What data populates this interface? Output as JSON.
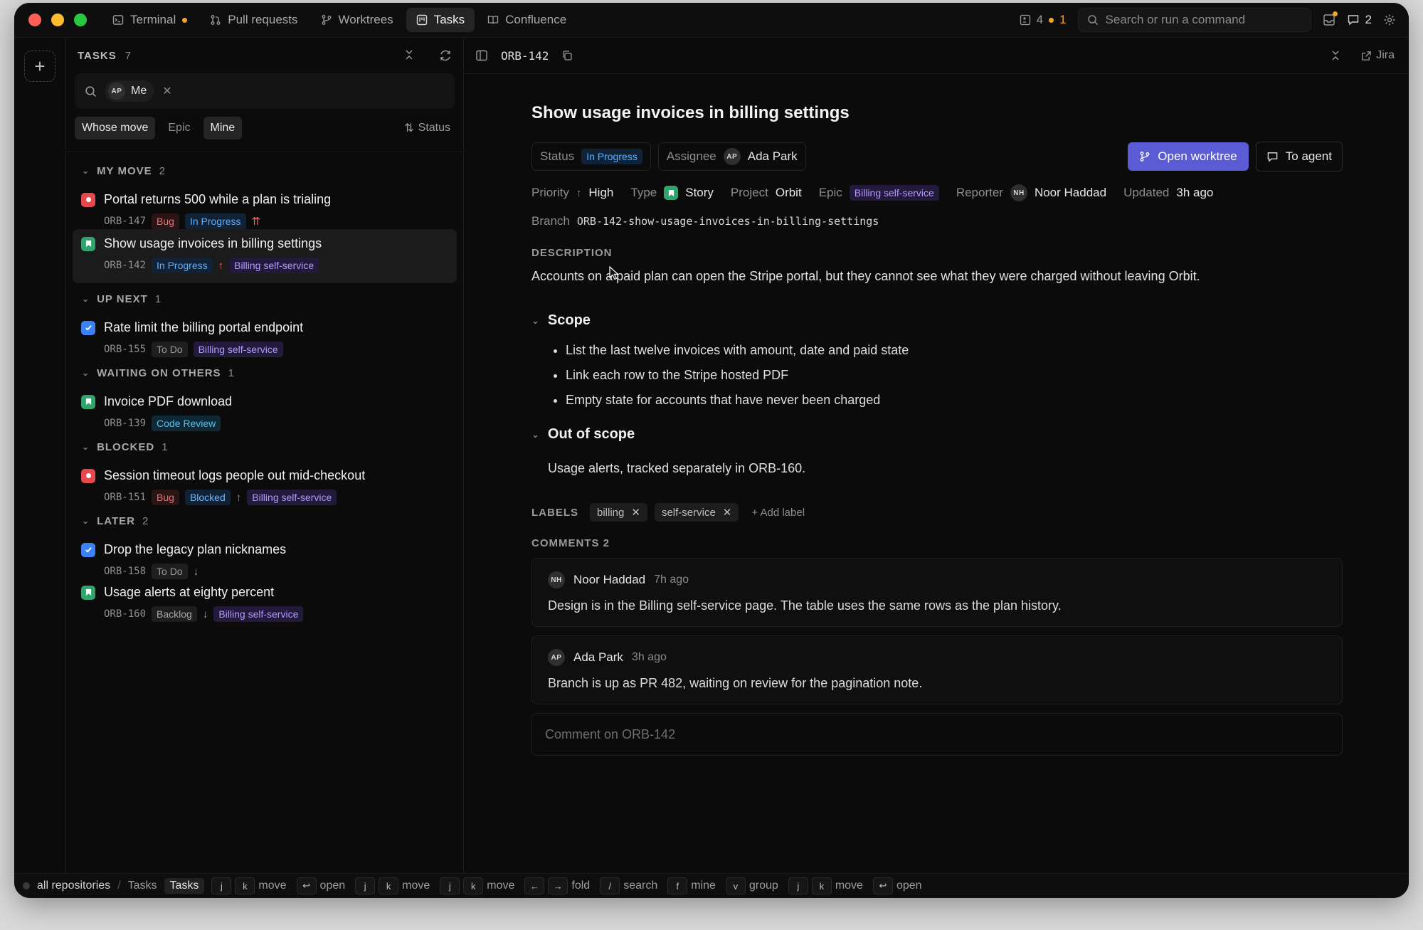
{
  "titlebar": {
    "tabs": [
      {
        "label": "Terminal",
        "icon": "terminal-icon",
        "dot": true
      },
      {
        "label": "Pull requests",
        "icon": "pull-request-icon"
      },
      {
        "label": "Worktrees",
        "icon": "branch-icon"
      },
      {
        "label": "Tasks",
        "icon": "kanban-icon",
        "active": true
      },
      {
        "label": "Confluence",
        "icon": "book-icon"
      }
    ],
    "pr_count": "4",
    "pr_dot_count": "1",
    "search_placeholder": "Search or run a command",
    "comments_count": "2"
  },
  "tasks_panel": {
    "header": "TASKS",
    "count": "7",
    "filter_chip": {
      "initials": "AP",
      "label": "Me"
    },
    "filters": [
      "Whose move",
      "Epic",
      "Mine"
    ],
    "sort_label": "Status",
    "groups": [
      {
        "name": "MY MOVE",
        "count": "2",
        "items": [
          {
            "title": "Portal returns 500 while a plan is trialing",
            "key": "ORB-147",
            "type": "bug",
            "badges": [
              {
                "t": "Bug",
                "k": "bug"
              },
              {
                "t": "In Progress",
                "k": "prog"
              }
            ],
            "priority": "⇈",
            "epic": ""
          },
          {
            "title": "Show usage invoices in billing settings",
            "key": "ORB-142",
            "type": "story",
            "badges": [
              {
                "t": "In Progress",
                "k": "prog"
              }
            ],
            "priority": "↑",
            "epic": "Billing self-service",
            "selected": true
          }
        ]
      },
      {
        "name": "UP NEXT",
        "count": "1",
        "items": [
          {
            "title": "Rate limit the billing portal endpoint",
            "key": "ORB-155",
            "type": "task",
            "badges": [
              {
                "t": "To Do",
                "k": "todo"
              }
            ],
            "priority": "",
            "epic": "Billing self-service"
          }
        ]
      },
      {
        "name": "WAITING ON OTHERS",
        "count": "1",
        "items": [
          {
            "title": "Invoice PDF download",
            "key": "ORB-139",
            "type": "story",
            "badges": [
              {
                "t": "Code Review",
                "k": "review"
              }
            ],
            "priority": "",
            "epic": ""
          }
        ]
      },
      {
        "name": "BLOCKED",
        "count": "1",
        "items": [
          {
            "title": "Session timeout logs people out mid-checkout",
            "key": "ORB-151",
            "type": "bug",
            "badges": [
              {
                "t": "Bug",
                "k": "bug"
              },
              {
                "t": "Blocked",
                "k": "blocked"
              }
            ],
            "priority": "↑",
            "epic": "Billing self-service"
          }
        ]
      },
      {
        "name": "LATER",
        "count": "2",
        "items": [
          {
            "title": "Drop the legacy plan nicknames",
            "key": "ORB-158",
            "type": "task",
            "badges": [
              {
                "t": "To Do",
                "k": "todo"
              }
            ],
            "priority": "↓",
            "epic": ""
          },
          {
            "title": "Usage alerts at eighty percent",
            "key": "ORB-160",
            "type": "story",
            "badges": [
              {
                "t": "Backlog",
                "k": "back"
              }
            ],
            "priority": "↓",
            "epic": "Billing self-service"
          }
        ]
      }
    ]
  },
  "detail": {
    "key": "ORB-142",
    "jira_label": "Jira",
    "title": "Show usage invoices in billing settings",
    "status_label": "Status",
    "status_value": "In Progress",
    "assignee_label": "Assignee",
    "assignee_initials": "AP",
    "assignee_name": "Ada Park",
    "open_worktree": "Open worktree",
    "to_agent": "To agent",
    "priority_label": "Priority",
    "priority_arrow": "↑",
    "priority_value": "High",
    "type_label": "Type",
    "type_value": "Story",
    "project_label": "Project",
    "project_value": "Orbit",
    "epic_label": "Epic",
    "epic_value": "Billing self-service",
    "reporter_label": "Reporter",
    "reporter_initials": "NH",
    "reporter_name": "Noor Haddad",
    "updated_label": "Updated",
    "updated_value": "3h ago",
    "branch_label": "Branch",
    "branch_value": "ORB-142-show-usage-invoices-in-billing-settings",
    "description_label": "DESCRIPTION",
    "description": "Accounts on a paid plan can open the Stripe portal, but they cannot see what they were charged without leaving Orbit.",
    "scope_heading": "Scope",
    "scope_items": [
      "List the last twelve invoices with amount, date and paid state",
      "Link each row to the Stripe hosted PDF",
      "Empty state for accounts that have never been charged"
    ],
    "oos_heading": "Out of scope",
    "oos_text": "Usage alerts, tracked separately in ORB-160.",
    "labels_label": "LABELS",
    "labels": [
      "billing",
      "self-service"
    ],
    "add_label": "Add label",
    "comments_label": "COMMENTS 2",
    "comments": [
      {
        "initials": "NH",
        "author": "Noor Haddad",
        "time": "7h ago",
        "body": "Design is in the Billing self-service page. The table uses the same rows as the plan history."
      },
      {
        "initials": "AP",
        "author": "Ada Park",
        "time": "3h ago",
        "body": "Branch is up as PR 482, waiting on review for the pagination note."
      }
    ],
    "comment_placeholder": "Comment on ORB-142"
  },
  "statusbar": {
    "repo": "all repositories",
    "crumb": "Tasks",
    "active": "Tasks",
    "hints": [
      {
        "keys": [
          "j",
          "k"
        ],
        "label": "move"
      },
      {
        "keys": [
          "↩"
        ],
        "label": "open"
      },
      {
        "keys": [
          "j",
          "k"
        ],
        "label": "move"
      },
      {
        "keys": [
          "j",
          "k"
        ],
        "label": "move"
      },
      {
        "keys": [
          "←",
          "→"
        ],
        "label": "fold"
      },
      {
        "keys": [
          "/"
        ],
        "label": "search"
      },
      {
        "keys": [
          "f"
        ],
        "label": "mine"
      },
      {
        "keys": [
          "v"
        ],
        "label": "group"
      },
      {
        "keys": [
          "j",
          "k"
        ],
        "label": "move"
      },
      {
        "keys": [
          "↩"
        ],
        "label": "open"
      }
    ]
  },
  "colors": {
    "accent": "#5b5bd6",
    "bug": "#e5484d",
    "story": "#30a46c",
    "task": "#3b82f6",
    "epic": "#b399ff"
  }
}
